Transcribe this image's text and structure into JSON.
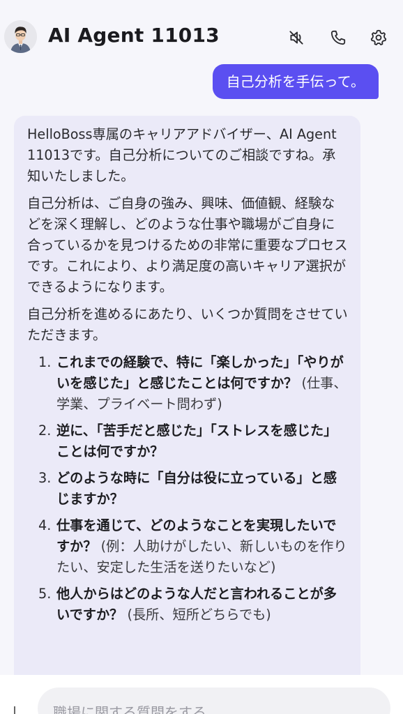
{
  "header": {
    "title": "AI Agent 11013",
    "icons": [
      "mute-icon",
      "phone-icon",
      "settings-icon"
    ]
  },
  "user_message": "自己分析を手伝って。",
  "assistant": {
    "paragraphs": [
      "HelloBoss専属のキャリアアドバイザー、AI Agent 11013です。自己分析についてのご相談ですね。承知いたしました。",
      "自己分析は、ご自身の強み、興味、価値観、経験などを深く理解し、どのような仕事や職場がご自身に合っているかを見つけるための非常に重要なプロセスです。これにより、より満足度の高いキャリア選択ができるようになります。",
      "自己分析を進めるにあたり、いくつか質問をさせていただきます。"
    ],
    "items": [
      {
        "num": "1.",
        "q": "これまでの経験で、特に「楽しかった」「やりがいを感じた」と感じたことは何ですか？",
        "note": "(仕事、学業、プライベート問わず)"
      },
      {
        "num": "2.",
        "q": "逆に、「苦手だと感じた」「ストレスを感じた」ことは何ですか？",
        "note": ""
      },
      {
        "num": "3.",
        "q": "どのような時に「自分は役に立っている」と感じますか？",
        "note": ""
      },
      {
        "num": "4.",
        "q": "仕事を通じて、どのようなことを実現したいですか？",
        "note": "(例：人助けがしたい、新しいものを作りたい、安定した生活を送りたいなど)"
      },
      {
        "num": "5.",
        "q": "他人からはどのような人だと言われることが多いですか？",
        "note": "(長所、短所どちらでも)"
      }
    ]
  },
  "input": {
    "placeholder": "職場に関する質問をする"
  },
  "colors": {
    "accent": "#5b4ff1",
    "assistant_bubble": "#ebeaf8",
    "background": "#f6f6fb"
  }
}
